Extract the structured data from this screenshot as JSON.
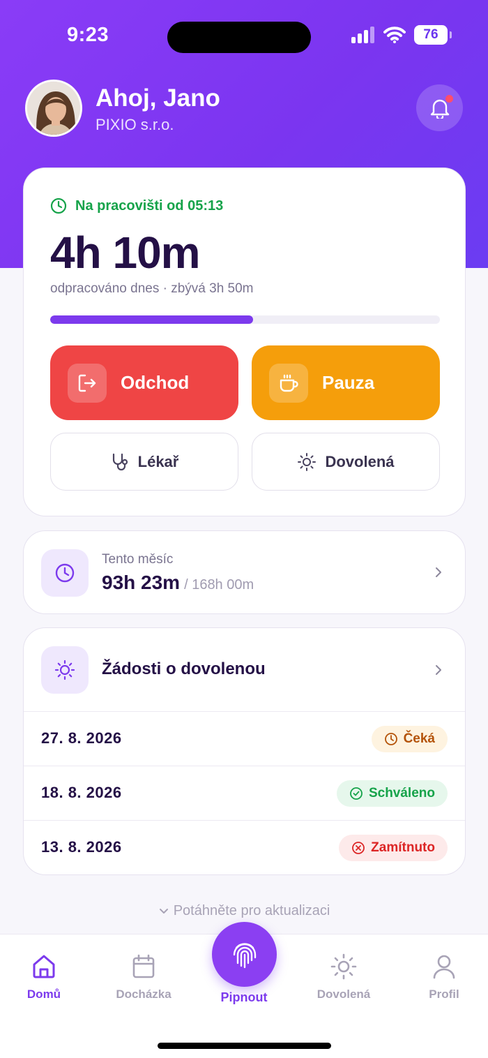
{
  "status_bar": {
    "time": "9:23",
    "battery": "76"
  },
  "header": {
    "greeting": "Ahoj, Jano",
    "company": "PIXIO s.r.o."
  },
  "today": {
    "status": "Na pracovišti od 05:13",
    "worked": "4h 10m",
    "subtitle": "odpracováno dnes · zbývá 3h 50m",
    "progress": 0.52,
    "actions": {
      "leave": "Odchod",
      "pause": "Pauza",
      "doctor": "Lékař",
      "vacation": "Dovolená"
    }
  },
  "month": {
    "label": "Tento měsíc",
    "worked": "93h 23m",
    "total": "/ 168h 00m"
  },
  "requests": {
    "title": "Žádosti o dovolenou",
    "items": [
      {
        "date": "27. 8. 2026",
        "status": "Čeká",
        "status_color": "#b45309"
      },
      {
        "date": "18. 8. 2026",
        "status": "Schváleno",
        "status_color": "#16a34a"
      },
      {
        "date": "13. 8. 2026",
        "status": "Zamítnuto",
        "status_color": "#dc2626"
      }
    ]
  },
  "pull_hint": "Potáhněte pro aktualizaci",
  "tabs": {
    "home": "Domů",
    "attendance": "Docházka",
    "clock": "Pipnout",
    "vacation": "Dovolená",
    "profile": "Profil"
  },
  "colors": {
    "accent": "#7c3aed",
    "leave": "#ef4545",
    "pause": "#f59e0b"
  }
}
